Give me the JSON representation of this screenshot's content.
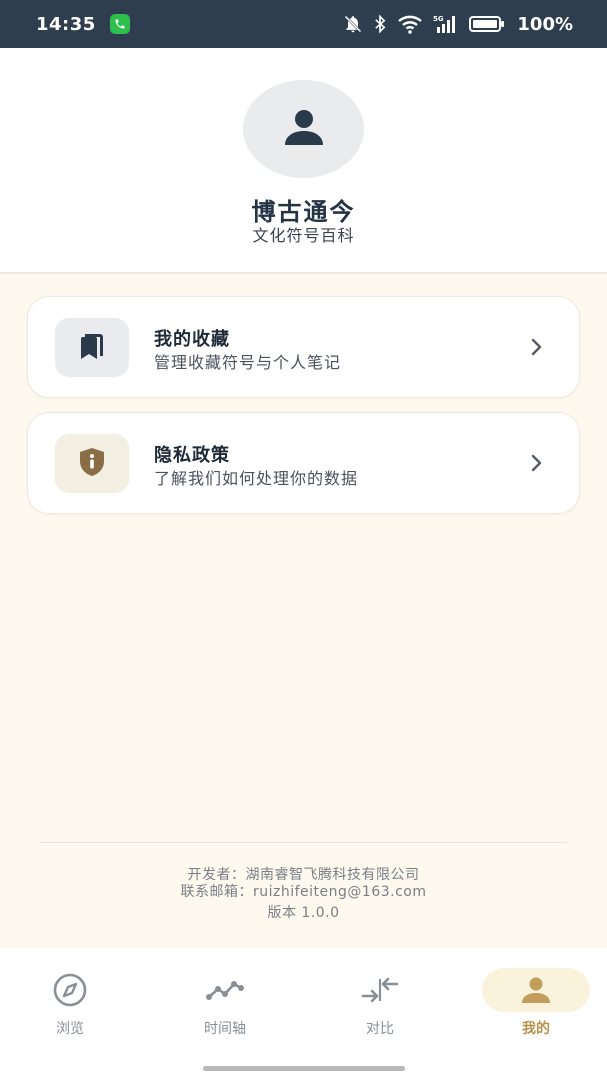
{
  "status_bar": {
    "time": "14:35",
    "battery": "100%",
    "network": "5G",
    "icons": [
      "phone-call-icon",
      "mute-icon",
      "bluetooth-icon",
      "wifi-icon",
      "signal-icon",
      "battery-icon"
    ]
  },
  "header": {
    "avatar_icon": "user-icon",
    "title": "博古通今",
    "subtitle": "文化符号百科"
  },
  "menu": {
    "favorites": {
      "title": "我的收藏",
      "description": "管理收藏符号与个人笔记",
      "icon": "bookmarks-icon"
    },
    "privacy": {
      "title": "隐私政策",
      "description": "了解我们如何处理你的数据",
      "icon": "shield-info-icon"
    }
  },
  "footer": {
    "developer": "开发者：湖南睿智飞腾科技有限公司",
    "email": "联系邮箱：ruizhifeiteng@163.com",
    "version": "版本 1.0.0"
  },
  "bottom_nav": {
    "items": [
      {
        "label": "浏览",
        "icon": "compass-icon"
      },
      {
        "label": "时间轴",
        "icon": "timeline-icon"
      },
      {
        "label": "对比",
        "icon": "compare-arrows-icon"
      },
      {
        "label": "我的",
        "icon": "user-icon"
      }
    ],
    "active_index": 3
  },
  "colors": {
    "status_bar": "#2e3e4e",
    "background": "#fdf9ef",
    "title": "#233344",
    "accent": "#b8934e",
    "shield": "#8a6d45"
  }
}
